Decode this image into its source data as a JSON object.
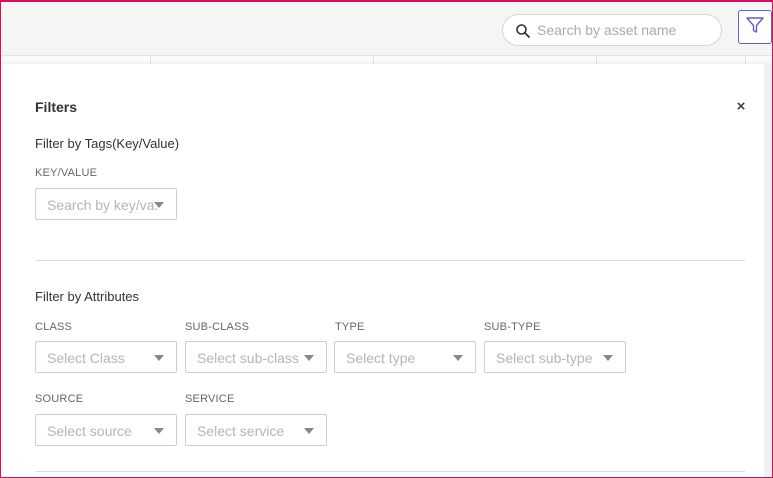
{
  "search": {
    "placeholder": "Search by asset name"
  },
  "filters_panel": {
    "title": "Filters",
    "close_label": "×",
    "tags_section": {
      "title": "Filter by Tags(Key/Value)",
      "key_value": {
        "label": "KEY/VALUE",
        "placeholder": "Search by key/va..."
      }
    },
    "attributes_section": {
      "title": "Filter by Attributes",
      "class": {
        "label": "CLASS",
        "placeholder": "Select Class"
      },
      "sub_class": {
        "label": "SUB-CLASS",
        "placeholder": "Select sub-class"
      },
      "type": {
        "label": "TYPE",
        "placeholder": "Select type"
      },
      "sub_type": {
        "label": "SUB-TYPE",
        "placeholder": "Select sub-type"
      },
      "source": {
        "label": "SOURCE",
        "placeholder": "Select source"
      },
      "service": {
        "label": "SERVICE",
        "placeholder": "Select service"
      }
    }
  },
  "colors": {
    "accent": "#6a5acd",
    "frame_border": "#c2185b"
  },
  "icons": {
    "search": "search-icon",
    "filter": "filter-icon",
    "close": "close-icon",
    "dropdown": "chevron-down-icon"
  }
}
